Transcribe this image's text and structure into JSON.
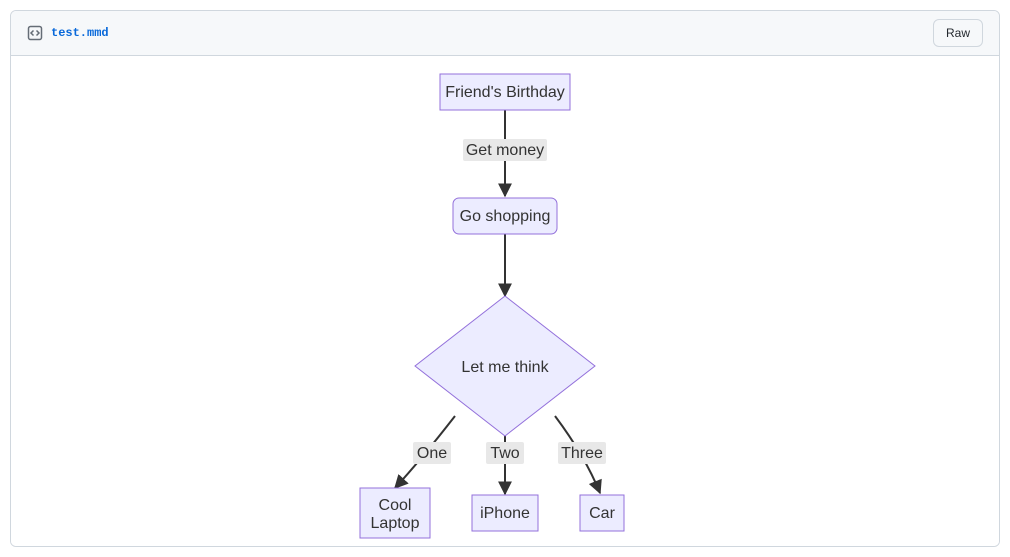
{
  "header": {
    "filename": "test.mmd",
    "raw_label": "Raw"
  },
  "diagram": {
    "nodes": {
      "a": "Friend's Birthday",
      "b": "Go shopping",
      "c": "Let me think",
      "d_line1": "Cool",
      "d_line2": "Laptop",
      "e": "iPhone",
      "f": "Car"
    },
    "edges": {
      "ab": "Get money",
      "cd": "One",
      "ce": "Two",
      "cf": "Three"
    }
  },
  "chart_data": {
    "type": "flowchart",
    "direction": "TD",
    "nodes": [
      {
        "id": "A",
        "label": "Friend's Birthday",
        "shape": "rect"
      },
      {
        "id": "B",
        "label": "Go shopping",
        "shape": "round"
      },
      {
        "id": "C",
        "label": "Let me think",
        "shape": "diamond"
      },
      {
        "id": "D",
        "label": "Cool Laptop",
        "shape": "rect"
      },
      {
        "id": "E",
        "label": "iPhone",
        "shape": "rect"
      },
      {
        "id": "F",
        "label": "Car",
        "shape": "rect"
      }
    ],
    "edges": [
      {
        "from": "A",
        "to": "B",
        "label": "Get money"
      },
      {
        "from": "B",
        "to": "C",
        "label": ""
      },
      {
        "from": "C",
        "to": "D",
        "label": "One"
      },
      {
        "from": "C",
        "to": "E",
        "label": "Two"
      },
      {
        "from": "C",
        "to": "F",
        "label": "Three"
      }
    ]
  }
}
